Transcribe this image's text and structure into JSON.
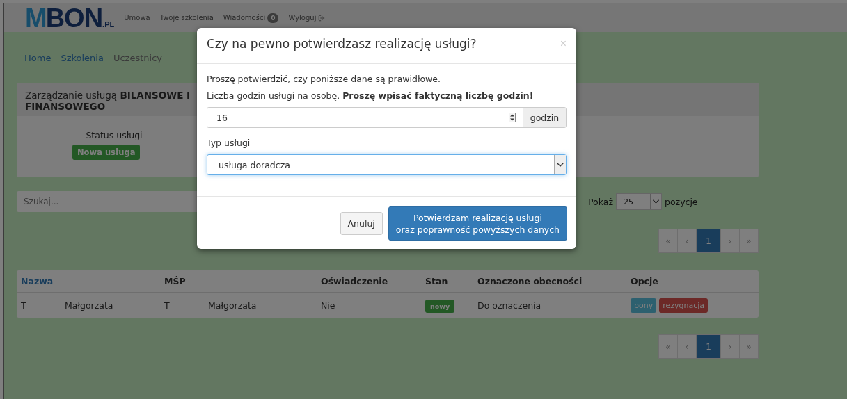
{
  "header": {
    "logo": {
      "first": "M",
      "rest": "BON",
      "suffix": ".PL"
    },
    "nav": [
      {
        "label": "Umowa",
        "kind": "link"
      },
      {
        "label": "Twoje szkolenia",
        "kind": "link"
      },
      {
        "label": "Wiadomości",
        "kind": "messages",
        "badge": "0"
      },
      {
        "label": "Wyloguj",
        "kind": "logout"
      }
    ]
  },
  "breadcrumb": [
    "Home",
    "Szkolenia",
    "Uczestnicy"
  ],
  "panel": {
    "title": "Zarządzanie usługą **BILANSOWE I FINANSOWEGO**",
    "status_label": "Status usługi",
    "status": "Nowa usługa"
  },
  "search": {
    "placeholder": "Szukaj..."
  },
  "page_size": {
    "label": "Pokaż",
    "value": "25",
    "suffix": "pozycje"
  },
  "pagination_top": [
    {
      "label": "«",
      "selected": false
    },
    {
      "label": "‹",
      "selected": false
    },
    {
      "label": "1",
      "selected": true
    },
    {
      "label": "›",
      "selected": false
    },
    {
      "label": "»",
      "selected": false
    }
  ],
  "table": {
    "columns": [
      {
        "label": "Nazwa",
        "kind": "link"
      },
      {
        "label": "MŚP",
        "kind": "plain"
      },
      {
        "label": "Oświadczenie",
        "kind": "plain"
      },
      {
        "label": "Stan",
        "kind": "plain"
      },
      {
        "label": "Oznaczone obecności",
        "kind": "plain"
      },
      {
        "label": "Opcje",
        "kind": "plain"
      }
    ],
    "rows": [
      {
        "name": [
          "T",
          "Małgorzata"
        ],
        "msp": [
          "T",
          "Małgorzata"
        ],
        "statement": "Nie",
        "state": "nowy",
        "attendance": "Do oznaczenia",
        "options": [
          {
            "label": "bony",
            "kind": "info"
          },
          {
            "label": "rezygnacja",
            "kind": "danger"
          }
        ]
      }
    ]
  },
  "pagination_bottom": [
    {
      "label": "«",
      "selected": false
    },
    {
      "label": "‹",
      "selected": false
    },
    {
      "label": "1",
      "selected": true
    },
    {
      "label": "›",
      "selected": false
    },
    {
      "label": "»",
      "selected": false
    }
  ],
  "modal": {
    "title": "Czy na pewno potwierdzasz realizację usługi?",
    "close": "×",
    "intro": "Proszę potwierdzić, czy poniższe dane są prawidłowe.",
    "hours_label": "Liczba godzin usługi na osobę. **Proszę wpisać faktyczną liczbę godzin!**",
    "hours_value": "16",
    "hours_unit": "godzin",
    "type_label": "Typ usługi",
    "type_value": "usługa doradcza",
    "cancel": "Anuluj",
    "confirm": [
      "Potwierdzam realizację usługi",
      "oraz poprawność powyższych danych"
    ]
  }
}
